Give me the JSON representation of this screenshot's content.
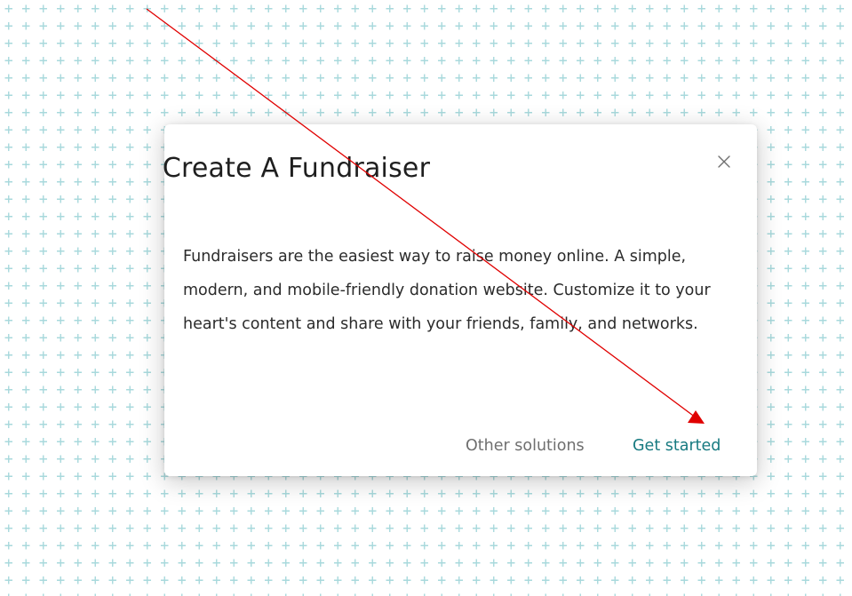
{
  "colors": {
    "pattern_plus": "#a8d9dc",
    "accent": "#177a80",
    "title_text": "#1f1f1f",
    "body_text": "#2b2b2b",
    "muted_text": "#6f6f6f",
    "annotation_arrow": "#e00000"
  },
  "dialog": {
    "title": "Create A Fundraiser",
    "close_icon": "close-icon",
    "body": "Fundraisers are the easiest way to raise money online. A simple, modern, and mobile-friendly donation website. Customize it to your heart's content and share with your friends, family, and networks.",
    "actions": {
      "secondary_label": "Other solutions",
      "primary_label": "Get started"
    }
  }
}
